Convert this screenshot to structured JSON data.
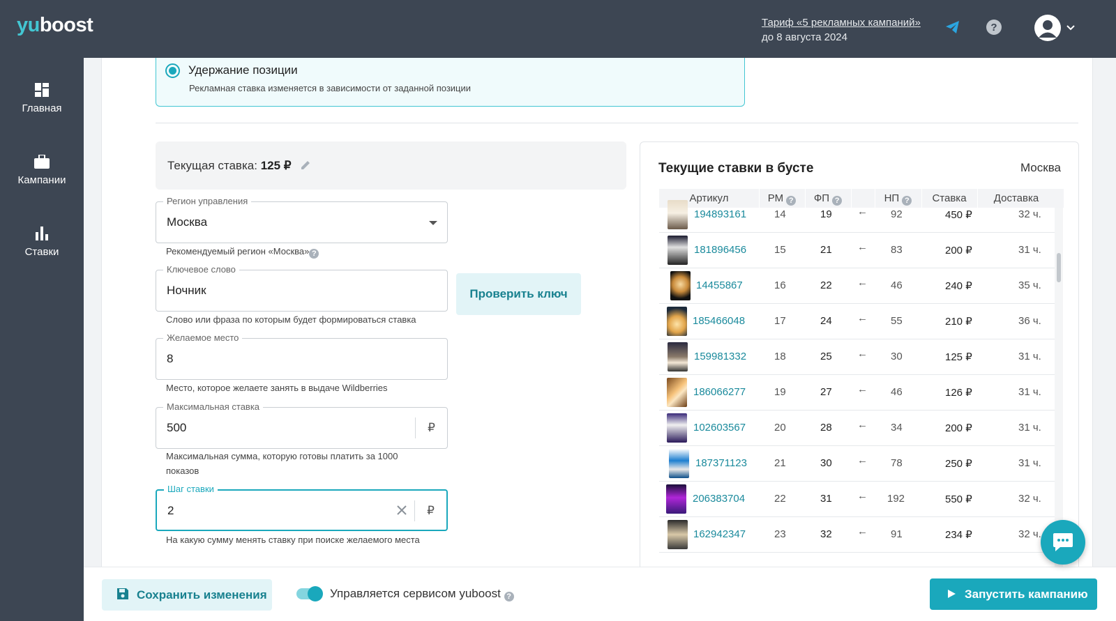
{
  "logo": {
    "part1": "yu",
    "part2": "boost"
  },
  "header": {
    "tariff_link": "Тариф «5 рекламных кампаний»",
    "tariff_until": "до 8 августа 2024",
    "icons": [
      "telegram-icon",
      "help-icon",
      "user-icon",
      "chevron-down-icon"
    ]
  },
  "sidebar": {
    "items": [
      {
        "label": "Главная",
        "icon": "dashboard-icon"
      },
      {
        "label": "Кампании",
        "icon": "briefcase-icon"
      },
      {
        "label": "Ставки",
        "icon": "bar-chart-icon"
      }
    ]
  },
  "strategy": {
    "title": "Удержание позиции",
    "description": "Рекламная ставка изменяется в зависимости от заданной позиции"
  },
  "current_rate": {
    "label": "Текущая ставка:",
    "value": "125 ₽"
  },
  "form": {
    "region": {
      "label": "Регион управления",
      "value": "Москва",
      "help": "Рекомендуемый регион «Москва»"
    },
    "keyword": {
      "label": "Ключевое слово",
      "value": "Ночник",
      "help": "Слово или фраза по которым будет формироваться ставка"
    },
    "check_button": "Проверить ключ",
    "place": {
      "label": "Желаемое место",
      "value": "8",
      "help": "Место, которое желаете занять в выдаче Wildberries"
    },
    "max_rate": {
      "label": "Максимальная ставка",
      "value": "500",
      "currency": "₽",
      "help": "Максимальная сумма, которую готовы платить за 1000 показов"
    },
    "step": {
      "label": "Шаг ставки",
      "value": "2",
      "currency": "₽",
      "help": "На какую сумму менять ставку при поиске желаемого места"
    }
  },
  "boost_panel": {
    "title": "Текущие ставки в бусте",
    "city": "Москва",
    "columns": [
      "Артикул",
      "РМ",
      "ФП",
      "",
      "НП",
      "Ставка",
      "Доставка"
    ],
    "rows": [
      {
        "article": "194893161",
        "rm": "14",
        "fp": "19",
        "np": "92",
        "rate": "450 ₽",
        "delivery": "32 ч."
      },
      {
        "article": "181896456",
        "rm": "15",
        "fp": "21",
        "np": "83",
        "rate": "200 ₽",
        "delivery": "31 ч."
      },
      {
        "article": "14455867",
        "rm": "16",
        "fp": "22",
        "np": "46",
        "rate": "240 ₽",
        "delivery": "35 ч."
      },
      {
        "article": "185466048",
        "rm": "17",
        "fp": "24",
        "np": "55",
        "rate": "210 ₽",
        "delivery": "36 ч."
      },
      {
        "article": "159981332",
        "rm": "18",
        "fp": "25",
        "np": "30",
        "rate": "125 ₽",
        "delivery": "31 ч."
      },
      {
        "article": "186066277",
        "rm": "19",
        "fp": "27",
        "np": "46",
        "rate": "126 ₽",
        "delivery": "31 ч."
      },
      {
        "article": "102603567",
        "rm": "20",
        "fp": "28",
        "np": "34",
        "rate": "200 ₽",
        "delivery": "31 ч."
      },
      {
        "article": "187371123",
        "rm": "21",
        "fp": "30",
        "np": "78",
        "rate": "250 ₽",
        "delivery": "31 ч."
      },
      {
        "article": "206383704",
        "rm": "22",
        "fp": "31",
        "np": "192",
        "rate": "550 ₽",
        "delivery": "32 ч."
      },
      {
        "article": "162942347",
        "rm": "23",
        "fp": "32",
        "np": "91",
        "rate": "234 ₽",
        "delivery": "32 ч."
      }
    ]
  },
  "footer": {
    "save_button": "Сохранить изменения",
    "managed_label": "Управляется сервисом yuboost",
    "managed_on": true,
    "launch_button": "Запустить кампанию"
  },
  "colors": {
    "accent": "#1aa8bc",
    "sidebar": "#3d4653",
    "link": "#1a8a9c"
  }
}
